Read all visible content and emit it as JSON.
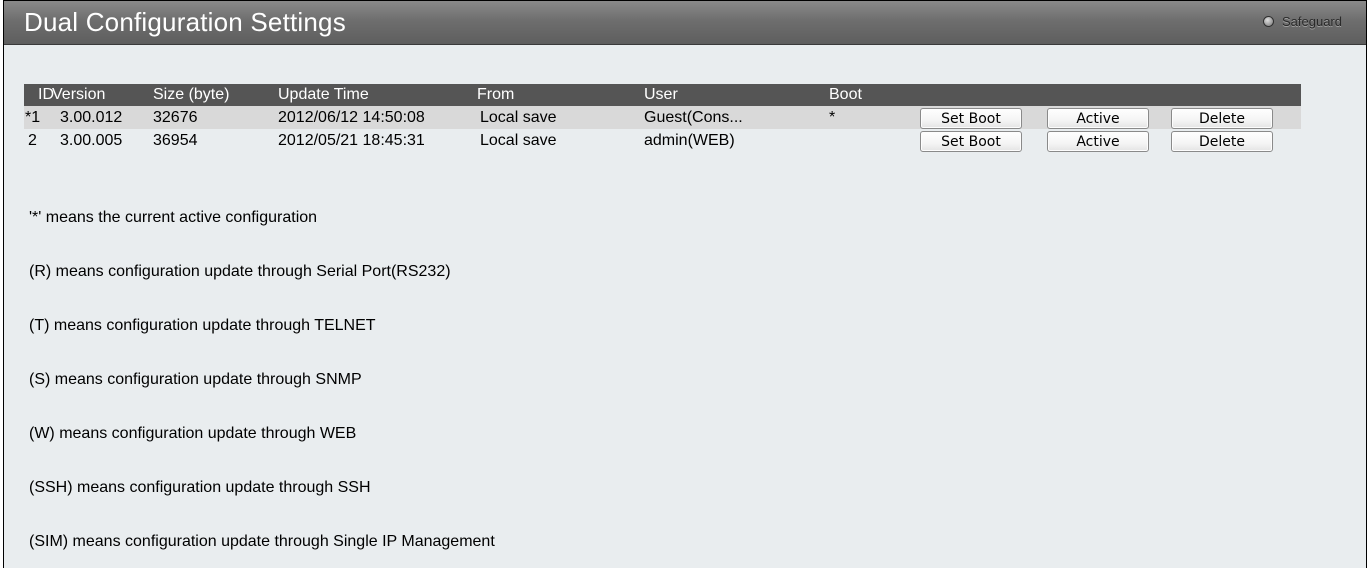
{
  "header": {
    "title": "Dual Configuration Settings",
    "safeguard_label": "Safeguard"
  },
  "table": {
    "columns": [
      "ID",
      "Version",
      "Size (byte)",
      "Update Time",
      "From",
      "User",
      "Boot"
    ],
    "rows": [
      {
        "id": "*1",
        "version": "3.00.012",
        "size": "32676",
        "update_time": "2012/06/12 14:50:08",
        "from": "Local save",
        "user": "Guest(Cons...",
        "boot": "*",
        "buttons": [
          "Set Boot",
          "Active",
          "Delete"
        ]
      },
      {
        "id": "2",
        "version": "3.00.005",
        "size": "36954",
        "update_time": "2012/05/21 18:45:31",
        "from": "Local save",
        "user": "admin(WEB)",
        "boot": "",
        "buttons": [
          "Set Boot",
          "Active",
          "Delete"
        ]
      }
    ]
  },
  "notes": [
    "'*' means the current active configuration",
    "(R) means configuration update through Serial Port(RS232)",
    "(T) means configuration update through TELNET",
    "(S) means configuration update through SNMP",
    "(W) means configuration update through WEB",
    "(SSH) means configuration update through SSH",
    "(SIM) means configuration update through Single IP Management"
  ]
}
